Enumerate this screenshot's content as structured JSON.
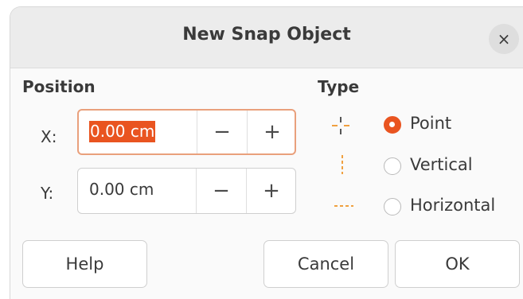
{
  "dialog": {
    "title": "New Snap Object",
    "close_glyph": "×"
  },
  "position": {
    "heading": "Position",
    "x": {
      "label": "X:",
      "value": "0.00 cm",
      "decrement": "−",
      "increment": "+"
    },
    "y": {
      "label": "Y:",
      "value": "0.00 cm",
      "decrement": "−",
      "increment": "+"
    }
  },
  "type": {
    "heading": "Type",
    "options": [
      {
        "label": "Point",
        "selected": true,
        "icon": "snap-point-icon"
      },
      {
        "label": "Vertical",
        "selected": false,
        "icon": "snap-vertical-icon"
      },
      {
        "label": "Horizontal",
        "selected": false,
        "icon": "snap-horizontal-icon"
      }
    ]
  },
  "buttons": {
    "help": "Help",
    "cancel": "Cancel",
    "ok": "OK"
  },
  "colors": {
    "accent": "#e95420",
    "focus_border": "#e9a07c",
    "icon": "#f0a040"
  }
}
